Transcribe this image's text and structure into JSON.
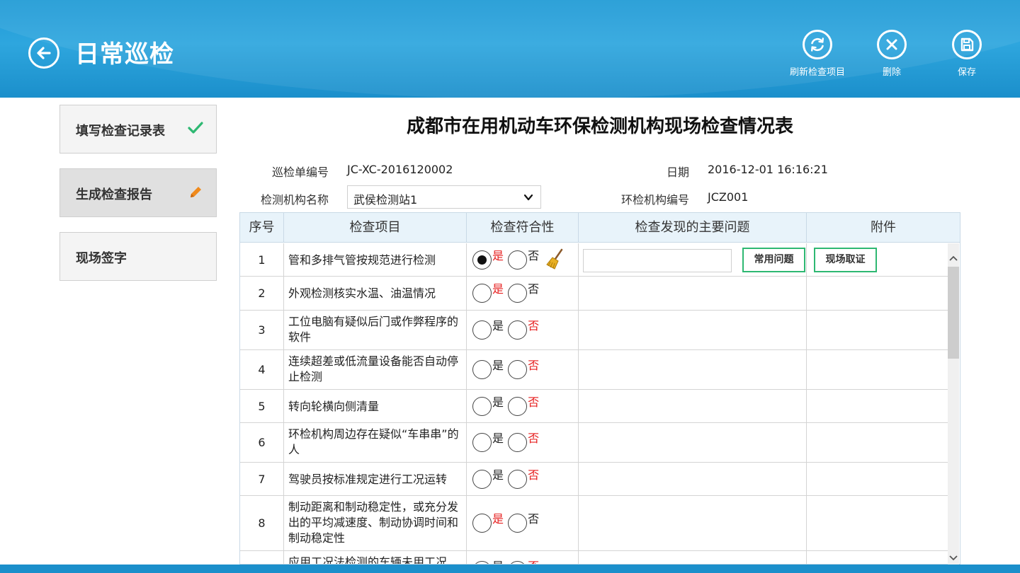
{
  "header": {
    "title": "日常巡检",
    "actions": [
      {
        "label": "刷新检查项目",
        "icon": "refresh-icon"
      },
      {
        "label": "删除",
        "icon": "close-icon"
      },
      {
        "label": "保存",
        "icon": "save-icon"
      }
    ]
  },
  "sidebar": {
    "items": [
      {
        "label": "填写检查记录表",
        "icon": "checkmark-icon",
        "active": false
      },
      {
        "label": "生成检查报告",
        "icon": "pencil-icon",
        "active": true
      },
      {
        "label": "现场签字",
        "icon": "",
        "active": false
      }
    ]
  },
  "form": {
    "title": "成都市在用机动车环保检测机构现场检查情况表",
    "inspection_no_label": "巡检单编号",
    "inspection_no": "JC-XC-2016120002",
    "date_label": "日期",
    "date": "2016-12-01 16:16:21",
    "agency_label": "检测机构名称",
    "agency": "武侯检测站1",
    "agency_code_label": "环检机构编号",
    "agency_code": "JCZ001"
  },
  "table": {
    "headers": [
      "序号",
      "检查项目",
      "检查符合性",
      "检查发现的主要问题",
      "附件"
    ],
    "yes_label": "是",
    "no_label": "否",
    "common_issue_button": "常用问题",
    "evidence_button": "现场取证",
    "rows": [
      {
        "no": "1",
        "item": "管和多排气管按规范进行检测",
        "selected": "yes",
        "highlight": "yes"
      },
      {
        "no": "2",
        "item": "外观检测核实水温、油温情况",
        "selected": "none",
        "highlight": "yes"
      },
      {
        "no": "3",
        "item": "工位电脑有疑似后门或作弊程序的软件",
        "selected": "none",
        "highlight": "no"
      },
      {
        "no": "4",
        "item": "连续超差或低流量设备能否自动停止检测",
        "selected": "none",
        "highlight": "no"
      },
      {
        "no": "5",
        "item": "转向轮横向侧清量",
        "selected": "none",
        "highlight": "no"
      },
      {
        "no": "6",
        "item": "环检机构周边存在疑似“车串串”的人",
        "selected": "none",
        "highlight": "no"
      },
      {
        "no": "7",
        "item": "驾驶员按标准规定进行工况运转",
        "selected": "none",
        "highlight": "no"
      },
      {
        "no": "8",
        "item": "制动距离和制动稳定性，或充分发出的平均减速度、制动协调时间和制动稳定性",
        "selected": "none",
        "highlight": "yes"
      },
      {
        "no": "",
        "item": "应用工况法检测的车辆未用工况",
        "selected": "none",
        "highlight": "no"
      }
    ]
  },
  "colors": {
    "header_blue": "#1f9ad6",
    "accent_green": "#2eb872",
    "highlight_red": "#e61e1e",
    "pencil_orange": "#f08a1c"
  }
}
